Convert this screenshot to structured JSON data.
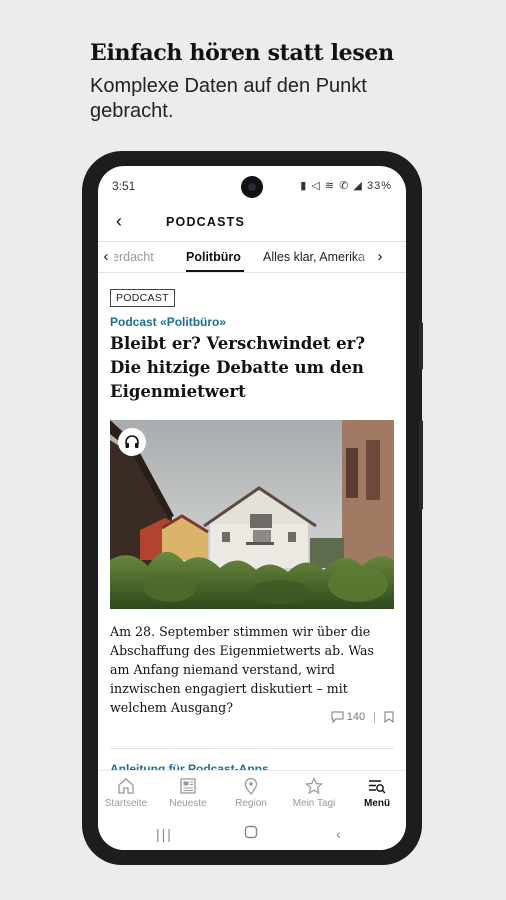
{
  "promo": {
    "title": "Einfach hören statt lesen",
    "subtitle": "Komplexe Daten auf den Punkt gebracht."
  },
  "statusbar": {
    "time": "3:51",
    "icons": "▮ ◁ ≋ ✆ ◢",
    "battery": "33%"
  },
  "appbar": {
    "back_icon": "chevron-left-icon",
    "title": "PODCASTS"
  },
  "tabs": {
    "items": [
      {
        "label": "erdacht",
        "state": "partial"
      },
      {
        "label": "Politbüro",
        "state": "active"
      },
      {
        "label": "Alles klar, Amerika",
        "state": "normal"
      }
    ]
  },
  "article": {
    "badge": "PODCAST",
    "kicker": "Podcast «Politbüro»",
    "headline": "Bleibt er? Verschwindet er? Die hitzige Debatte um den Eigenmietwert",
    "lead": "Am 28. September stimmen wir über die Abschaffung des Eigenmietwerts ab. Was am Anfang niemand verstand, wird inzwischen engagiert diskutiert – mit welchem Ausgang?",
    "comment_count": "140",
    "next_title": "Anleitung für Podcast-Apps"
  },
  "bottomnav": {
    "items": [
      {
        "label": "Startseite",
        "icon": "home-icon"
      },
      {
        "label": "Neueste",
        "icon": "newspaper-icon"
      },
      {
        "label": "Region",
        "icon": "location-pin-icon"
      },
      {
        "label": "Mein Tagi",
        "icon": "star-icon"
      },
      {
        "label": "Menü",
        "icon": "menu-search-icon",
        "active": true
      }
    ]
  },
  "colors": {
    "accent": "#1d6f8f",
    "background": "#ececec",
    "phone": "#1d1d1d"
  }
}
